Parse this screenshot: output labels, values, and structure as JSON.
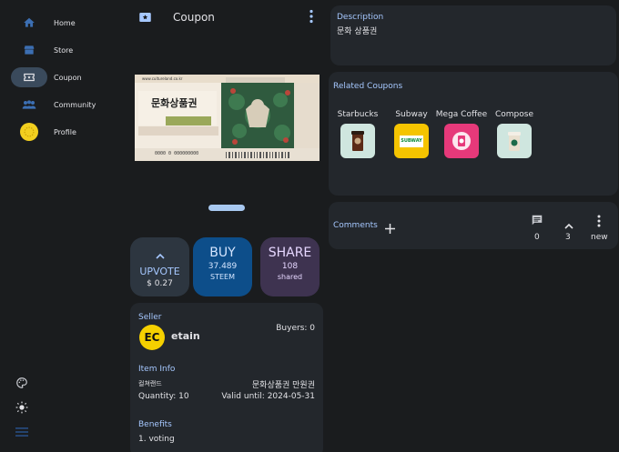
{
  "sidebar": {
    "items": [
      {
        "label": "Home",
        "icon": "home-icon"
      },
      {
        "label": "Store",
        "icon": "store-icon"
      },
      {
        "label": "Coupon",
        "icon": "ticket-icon"
      },
      {
        "label": "Community",
        "icon": "community-icon"
      },
      {
        "label": "Profile",
        "icon": "profile-avatar"
      }
    ],
    "bottom": [
      "palette-icon",
      "brightness-icon",
      "menu-icon"
    ]
  },
  "header": {
    "title": "Coupon"
  },
  "coupon_image": {
    "site": "www.cultureland.co.kr",
    "text": "문화상품권",
    "serial": "0000 0 000000000"
  },
  "actions": {
    "upvote": {
      "label": "UPVOTE",
      "value": "$ 0.27"
    },
    "buy": {
      "label": "BUY",
      "value": "37.489",
      "unit": "STEEM"
    },
    "share": {
      "label": "SHARE",
      "value": "108",
      "unit": "shared"
    }
  },
  "seller": {
    "section_label": "Seller",
    "avatar_text": "EC",
    "name": "etain",
    "buyers": "Buyers: 0"
  },
  "item_info": {
    "section_label": "Item Info",
    "brand": "컬쳐랜드",
    "product": "문화상품권 만원권",
    "quantity": "Quantity: 10",
    "valid_until": "Valid until: 2024-05-31"
  },
  "benefits": {
    "section_label": "Benefits",
    "item1": "1. voting"
  },
  "description": {
    "label": "Description",
    "text": "문화 상품권"
  },
  "related": {
    "label": "Related Coupons",
    "items": [
      {
        "name": "Starbucks"
      },
      {
        "name": "Subway",
        "logo_text": "SUBWAY"
      },
      {
        "name": "Mega Coffee"
      },
      {
        "name": "Compose"
      }
    ]
  },
  "comments": {
    "label": "Comments",
    "count": "0",
    "votes": "3",
    "sort": "new"
  },
  "colors": {
    "accent": "#a6c8ff",
    "background": "#1a1c1e",
    "card": "#23272c",
    "buy": "#0d4e8a",
    "share": "#3e3350"
  }
}
